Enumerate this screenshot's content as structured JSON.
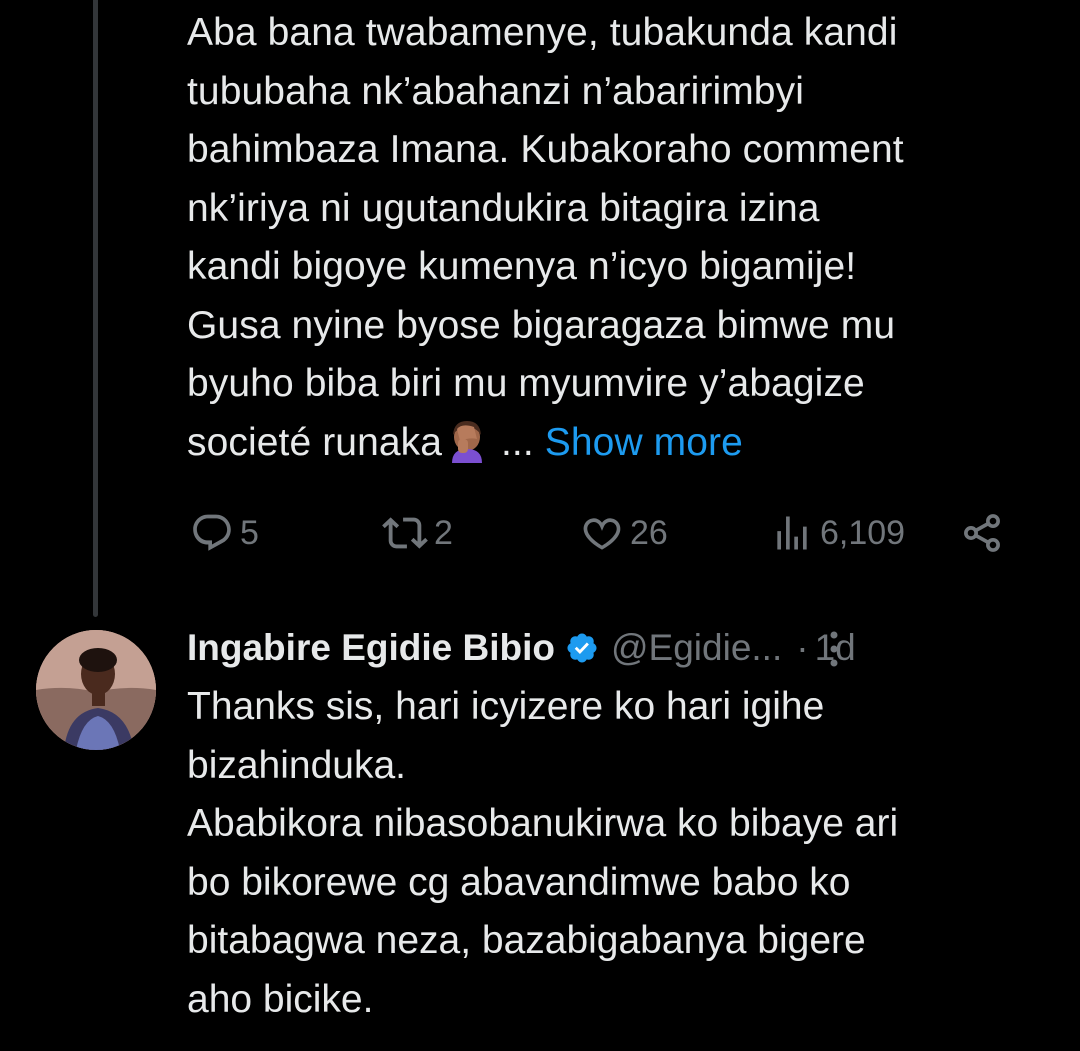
{
  "parent_tweet": {
    "text": "Aba bana twabamenye, tubakunda kandi\ntububaha nk’abahanzi n’abaririmbyi\nbahimbaza Imana. Kubakoraho comment\nnk’iriya ni ugutandukira bitagira izina\nkandi bigoye kumenya n’icyo bigamije!\nGusa nyine byose bigaragaza bimwe mu\nbyuho biba biri mu myumvire y’abagize\nsocieté runaka",
    "emoji": "facepalm-emoji",
    "ellipsis": " ... ",
    "show_more": "Show more",
    "actions": {
      "replies": "5",
      "retweets": "2",
      "likes": "26",
      "views": "6,109"
    }
  },
  "reply_tweet": {
    "display_name": "Ingabire Egidie Bibio",
    "handle": "@Egidie...",
    "separator": "·",
    "time": "1d",
    "text": "Thanks sis, hari icyizere ko hari igihe\nbizahinduka.\nAbabikora nibasobanukirwa ko bibaye ari\nbo bikorewe cg abavandimwe babo ko\nbitabagwa neza, bazabigabanya bigere\naho bicike."
  },
  "colors": {
    "background": "#000000",
    "text": "#e7e9ea",
    "muted": "#71767b",
    "accent": "#1d9bf0",
    "thread_line": "#333639"
  }
}
